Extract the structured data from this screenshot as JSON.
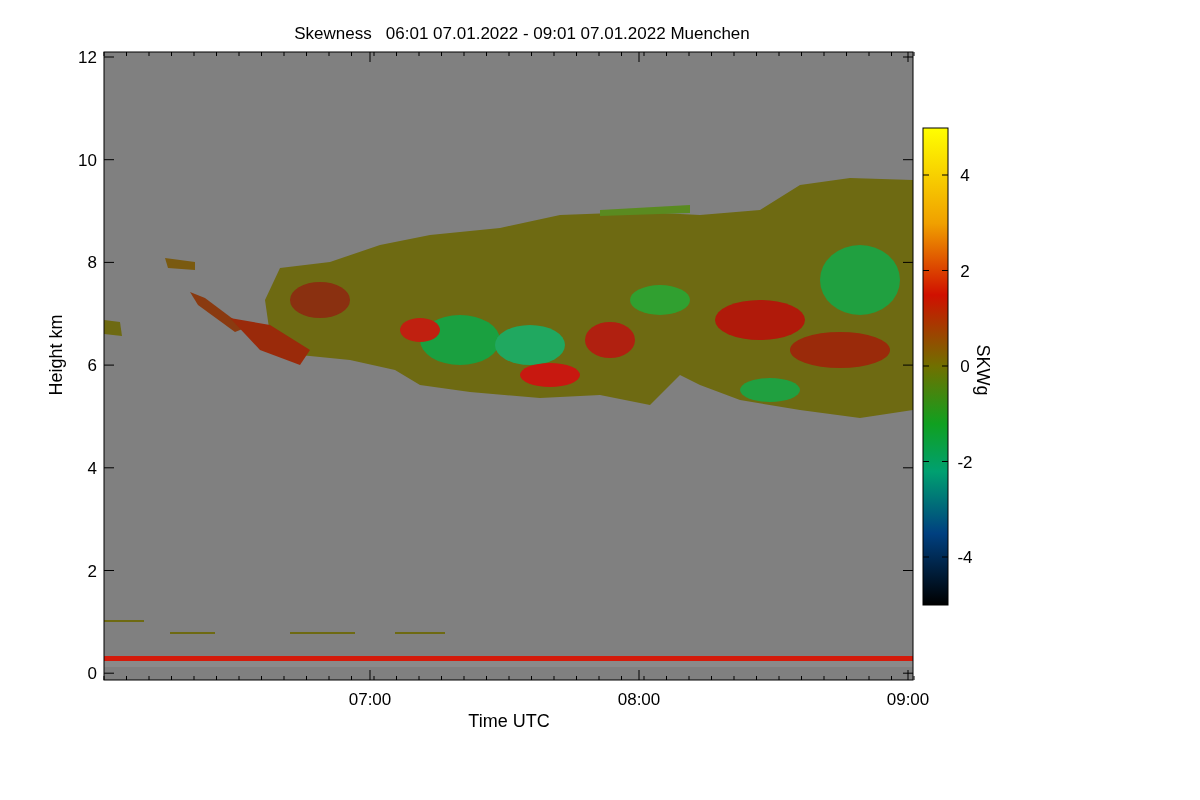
{
  "title": "Skewness   06:01 07.01.2022 - 09:01 07.01.2022 Muenchen",
  "y_axis": {
    "label": "Height km",
    "ticks": [
      "12",
      "10",
      "8",
      "6",
      "4",
      "2",
      "0"
    ]
  },
  "x_axis": {
    "label": "Time UTC",
    "ticks": [
      "07:00",
      "08:00",
      "09:00"
    ]
  },
  "colorbar": {
    "label": "SKWg",
    "ticks": [
      "4",
      "2",
      "0",
      "-2",
      "-4"
    ]
  }
}
